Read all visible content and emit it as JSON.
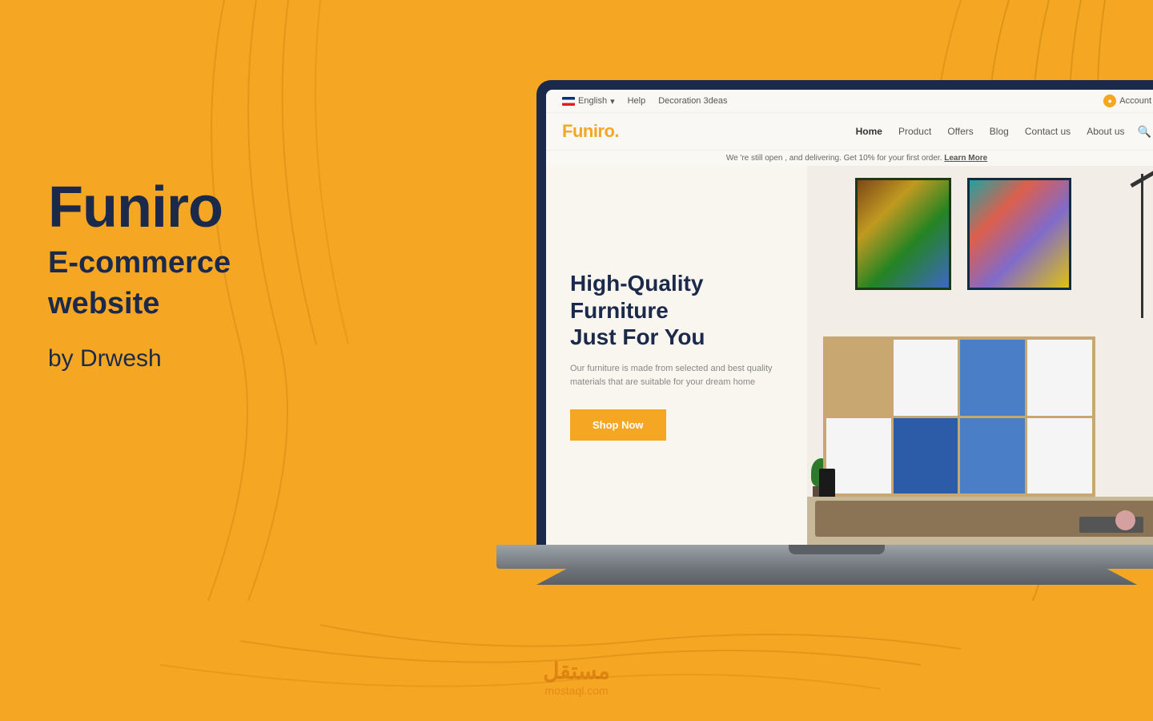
{
  "page": {
    "background_color": "#F5A623",
    "title": "Funiro E-commerce website"
  },
  "left_panel": {
    "brand_name": "Funiro",
    "subtitle": "E-commerce",
    "subtitle2": "website",
    "author_label": "by Drwesh"
  },
  "laptop": {
    "top_bar": {
      "language": "English",
      "help": "Help",
      "decoration": "Decoration 3deas",
      "account": "Account"
    },
    "navbar": {
      "logo": "Funiro.",
      "links": [
        {
          "label": "Home",
          "active": true
        },
        {
          "label": "Product",
          "active": false
        },
        {
          "label": "Offers",
          "active": false
        },
        {
          "label": "Blog",
          "active": false
        },
        {
          "label": "Contact us",
          "active": false
        },
        {
          "label": "About us",
          "active": false
        }
      ]
    },
    "announcement": {
      "text": "We 're still open , and delivering. Get 10% for your first order.",
      "link_text": "Learn More"
    },
    "hero": {
      "title_line1": "High-Quality",
      "title_line2": "Furniture",
      "title_line3": "Just For You",
      "description": "Our furniture is made from selected and best quality materials that are suitable for your dream home",
      "cta_button": "Shop Now"
    }
  },
  "watermark": {
    "logo": "مستقل",
    "url": "mostaql.com"
  }
}
